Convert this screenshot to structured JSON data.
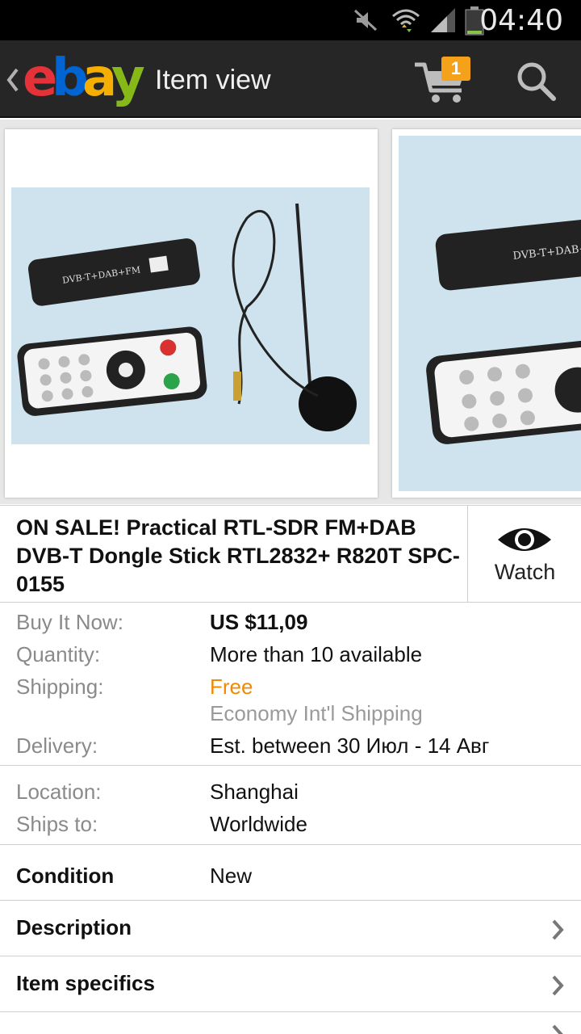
{
  "status_bar": {
    "time": "04:40",
    "icons": [
      "mute-icon",
      "wifi-icon",
      "signal-icon",
      "battery-icon"
    ]
  },
  "action_bar": {
    "logo": "ebay",
    "title": "Item view",
    "cart_count": "1",
    "icons": [
      "back-chevron-icon",
      "cart-icon",
      "search-icon"
    ]
  },
  "gallery": {
    "images": [
      {
        "caption_on_device": "DVB-T+DAB+FM"
      },
      {
        "caption_on_device": "DVB-T+DAB+"
      }
    ]
  },
  "item": {
    "title": "ON SALE! Practical  RTL-SDR FM+DAB DVB-T Dongle Stick  RTL2832+ R820T SPC-0155",
    "watch_label": "Watch"
  },
  "details": {
    "buy_now_label": "Buy It Now:",
    "buy_now_value": "US $11,09",
    "quantity_label": "Quantity:",
    "quantity_value": "More than 10 available",
    "shipping_label": "Shipping:",
    "shipping_value": "Free",
    "shipping_method": "Economy Int'l Shipping",
    "delivery_label": "Delivery:",
    "delivery_value": "Est. between 30 Июл - 14 Авг",
    "location_label": "Location:",
    "location_value": "Shanghai",
    "ships_to_label": "Ships to:",
    "ships_to_value": "Worldwide",
    "condition_label": "Condition",
    "condition_value": "New"
  },
  "sections": {
    "description": "Description",
    "item_specifics": "Item specifics"
  },
  "colors": {
    "ebay_red": "#e53238",
    "ebay_blue": "#0064d2",
    "ebay_yellow": "#f5af02",
    "ebay_green": "#86b817",
    "accent_orange": "#f08a00"
  }
}
